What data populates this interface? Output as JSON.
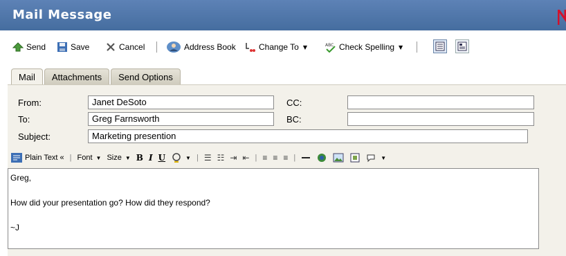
{
  "window": {
    "title": "Mail Message"
  },
  "toolbar": {
    "send": "Send",
    "save": "Save",
    "cancel": "Cancel",
    "address_book": "Address Book",
    "change_to": "Change To",
    "check_spelling": "Check Spelling"
  },
  "tabs": [
    {
      "label": "Mail",
      "active": true
    },
    {
      "label": "Attachments",
      "active": false
    },
    {
      "label": "Send Options",
      "active": false
    }
  ],
  "fields": {
    "from_label": "From:",
    "from_value": "Janet DeSoto",
    "to_label": "To:",
    "to_value": "Greg Farnsworth",
    "cc_label": "CC:",
    "cc_value": "",
    "bc_label": "BC:",
    "bc_value": "",
    "subject_label": "Subject:",
    "subject_value": "Marketing presention"
  },
  "format_toolbar": {
    "plain_text": "Plain Text «",
    "font": "Font",
    "size": "Size",
    "bold": "B",
    "italic": "I",
    "underline": "U"
  },
  "body": {
    "line1": "Greg,",
    "line2": "",
    "line3": "How did your presentation go? How did they respond?",
    "line4": "",
    "line5": "~J"
  },
  "colors": {
    "title_bar": "#4f76aa",
    "panel": "#f3f1ea",
    "brand": "#d4102a"
  },
  "icons": [
    "send-icon",
    "save-icon",
    "cancel-icon",
    "address-book-icon",
    "change-to-icon",
    "spell-check-icon",
    "view-icon",
    "list-view-icon",
    "plain-text-icon",
    "highlight-icon",
    "numbered-list-icon",
    "bullet-list-icon",
    "indent-icon",
    "outdent-icon",
    "align-left-icon",
    "align-center-icon",
    "align-right-icon",
    "horizontal-rule-icon",
    "link-icon",
    "image-icon",
    "insert-icon",
    "emoticon-icon"
  ]
}
